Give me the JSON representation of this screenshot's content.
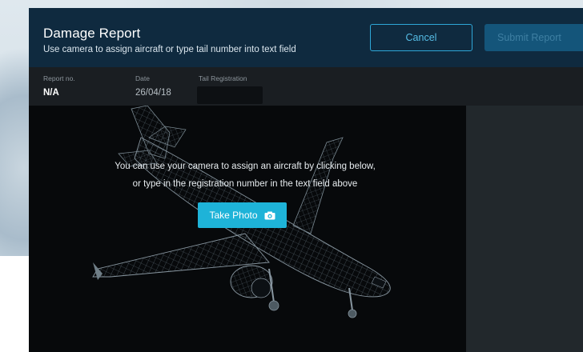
{
  "header": {
    "title": "Damage Report",
    "subtitle": "Use camera to assign aircraft or type tail number into text field",
    "cancel_label": "Cancel",
    "submit_label": "Submit Report"
  },
  "info": {
    "report_no_label": "Report no.",
    "report_no_value": "N/A",
    "date_label": "Date",
    "date_value": "26/04/18",
    "tail_label": "Tail Registration",
    "tail_value": "",
    "tail_placeholder": ""
  },
  "viewer": {
    "message_line1": "You can use your camera to assign an aircraft by clicking below,",
    "message_line2": "or type in the registration number in the text field above",
    "take_photo_label": "Take Photo",
    "photo_icon": "camera-icon"
  },
  "colors": {
    "header_bg": "#0f2a3f",
    "accent": "#1eb3d8",
    "submit_disabled_bg": "#14557a",
    "infobar_bg": "#1a1e22",
    "viewer_bg": "#07090b",
    "side_panel_bg": "#22282c"
  }
}
